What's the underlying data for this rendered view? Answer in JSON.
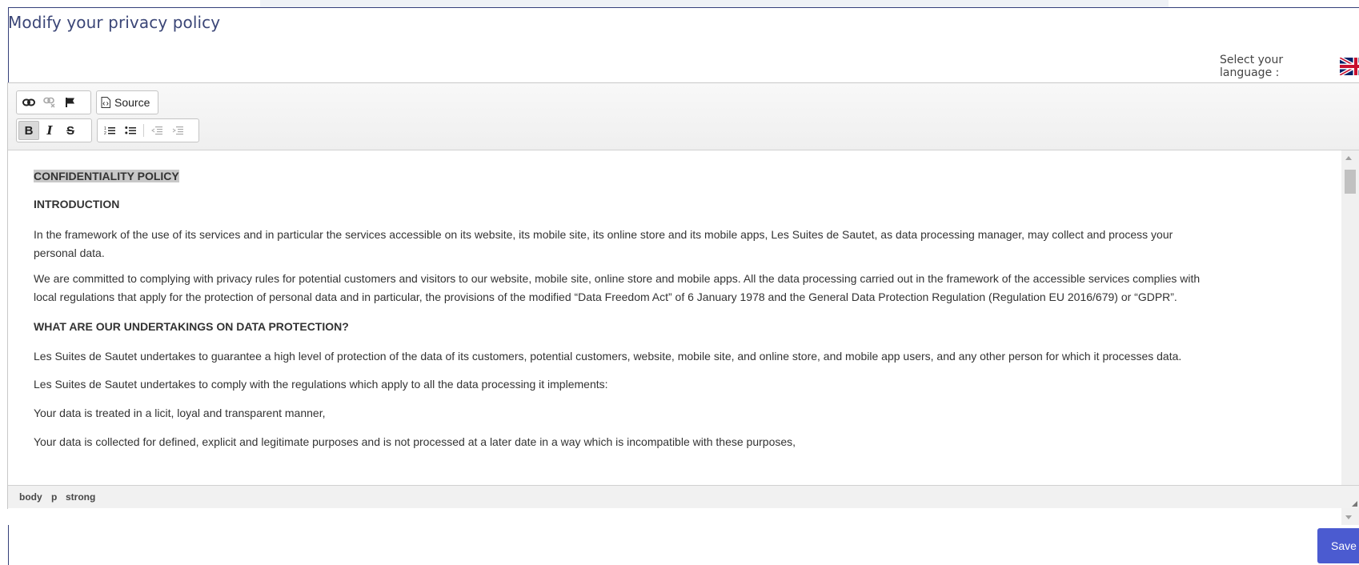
{
  "page": {
    "title": "Modify your privacy policy",
    "language_label": "Select your language :"
  },
  "toolbar": {
    "source_label": "Source",
    "bold_label": "B",
    "italic_label": "I",
    "strike_label": "S",
    "bold_active": true
  },
  "content": {
    "heading1": "CONFIDENTIALITY POLICY",
    "heading2": "INTRODUCTION",
    "para1": "In the framework of the use of its services and in particular the services accessible on its website, its mobile site, its online store and its mobile apps, Les Suites de Sautet, as data processing manager, may collect and process your personal data.",
    "para2": "We are committed to complying with privacy rules for potential customers and visitors to our website, mobile site, online store and mobile apps. All the data processing carried out in the framework of the accessible services complies with local regulations that apply for the protection of personal data and in particular, the provisions of the modified “Data Freedom Act” of 6 January 1978 and the General Data Protection Regulation (Regulation EU 2016/679) or “GDPR”.",
    "heading3": "WHAT ARE OUR UNDERTAKINGS ON DATA PROTECTION?",
    "para3": "Les Suites de Sautet undertakes to guarantee a high level of protection of the data of its customers, potential customers, website, mobile site, and online store, and mobile app users, and any other person for which it processes data.",
    "para4": "Les Suites de Sautet undertakes to comply with the regulations which apply to all the data processing it implements:",
    "para5": "Your data is treated in a licit, loyal and transparent manner,",
    "para6": "Your data is collected for defined, explicit and legitimate purposes and is not processed at a later date in a way which is incompatible with these purposes,"
  },
  "elements_path": [
    "body",
    "p",
    "strong"
  ],
  "save_label": "Save",
  "colors": {
    "title": "#3b4677",
    "frame_border": "#35407a",
    "save_button": "#4b5bd0",
    "highlight": "#c8c8c8"
  },
  "icons": [
    "link-icon",
    "unlink-icon",
    "anchor-flag-icon",
    "source-icon",
    "numbered-list-icon",
    "bulleted-list-icon",
    "outdent-icon",
    "indent-icon",
    "uk-flag-icon"
  ]
}
